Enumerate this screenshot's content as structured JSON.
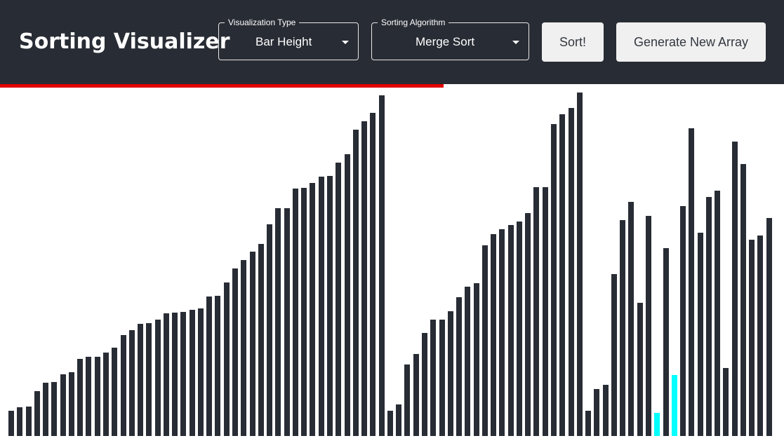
{
  "app": {
    "title": "Sorting Visualizer"
  },
  "controls": {
    "visualization": {
      "legend": "Visualization Type",
      "value": "Bar Height"
    },
    "algorithm": {
      "legend": "Sorting Algorithm",
      "value": "Merge Sort"
    },
    "sort_label": "Sort!",
    "generate_label": "Generate New Array"
  },
  "progress": {
    "fraction": 0.566
  },
  "colors": {
    "header": "#282c34",
    "bar": "#282c34",
    "highlight": "#00ffff",
    "progress": "#e00000"
  },
  "array": {
    "max_value": 490,
    "values": [
      36,
      41,
      42,
      64,
      76,
      77,
      88,
      91,
      110,
      113,
      113,
      119,
      126,
      144,
      151,
      160,
      161,
      166,
      175,
      176,
      177,
      180,
      182,
      199,
      200,
      219,
      239,
      251,
      263,
      274,
      302,
      325,
      325,
      353,
      354,
      361,
      370,
      371,
      390,
      402,
      437,
      449,
      461,
      486,
      36,
      45,
      102,
      117,
      147,
      166,
      166,
      178,
      198,
      213,
      218,
      272,
      288,
      295,
      301,
      306,
      318,
      355,
      355,
      445,
      459,
      468,
      490,
      36,
      67,
      73,
      231,
      308,
      334,
      190,
      314,
      33,
      268,
      87,
      328,
      439,
      290,
      341,
      350,
      97,
      420,
      388,
      280,
      286,
      311
    ],
    "highlighted": [
      75,
      77
    ]
  }
}
